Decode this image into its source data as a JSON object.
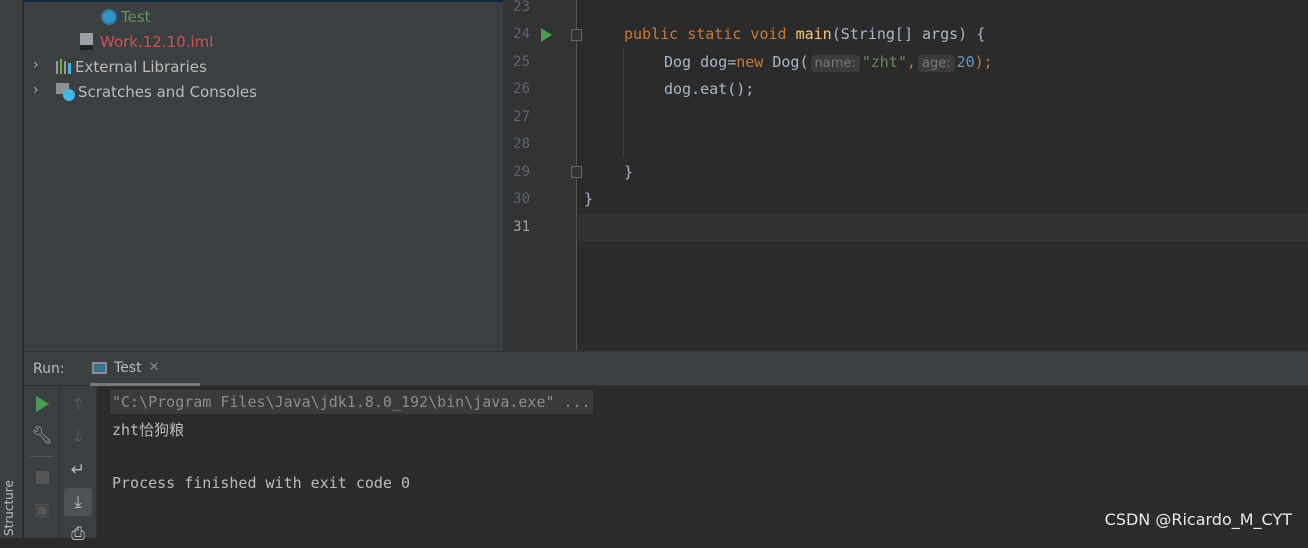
{
  "sidebar": {
    "structure_label": "Structure"
  },
  "project_tree": {
    "items": [
      {
        "label": "Test",
        "icon": "java-class-run-icon",
        "color": "#629755"
      },
      {
        "label": "Work.12.10.iml",
        "icon": "iml-file-icon",
        "color": "#d25252"
      },
      {
        "label": "External Libraries",
        "icon": "libraries-icon"
      },
      {
        "label": "Scratches and Consoles",
        "icon": "scratches-icon"
      }
    ]
  },
  "editor": {
    "line_numbers": [
      "23",
      "24",
      "25",
      "26",
      "27",
      "28",
      "29",
      "30",
      "31"
    ],
    "code": {
      "l24": {
        "kw": "public static void ",
        "fn": "main",
        "rest": "(String[] args) {"
      },
      "l25": {
        "a": "Dog dog=",
        "kw": "new",
        "b": " Dog(",
        "hint1": "name:",
        "str": "\"zht\"",
        "c": ",",
        "hint2": "age:",
        "num": "20",
        "d": ");"
      },
      "l26": "dog.eat();",
      "l29": "}",
      "l30": "}"
    }
  },
  "run": {
    "label": "Run:",
    "tab": "Test",
    "console": [
      "\"C:\\Program Files\\Java\\jdk1.8.0_192\\bin\\java.exe\" ...",
      "zht恰狗粮",
      "",
      "Process finished with exit code 0"
    ]
  },
  "watermark": "CSDN @Ricardo_M_CYT"
}
